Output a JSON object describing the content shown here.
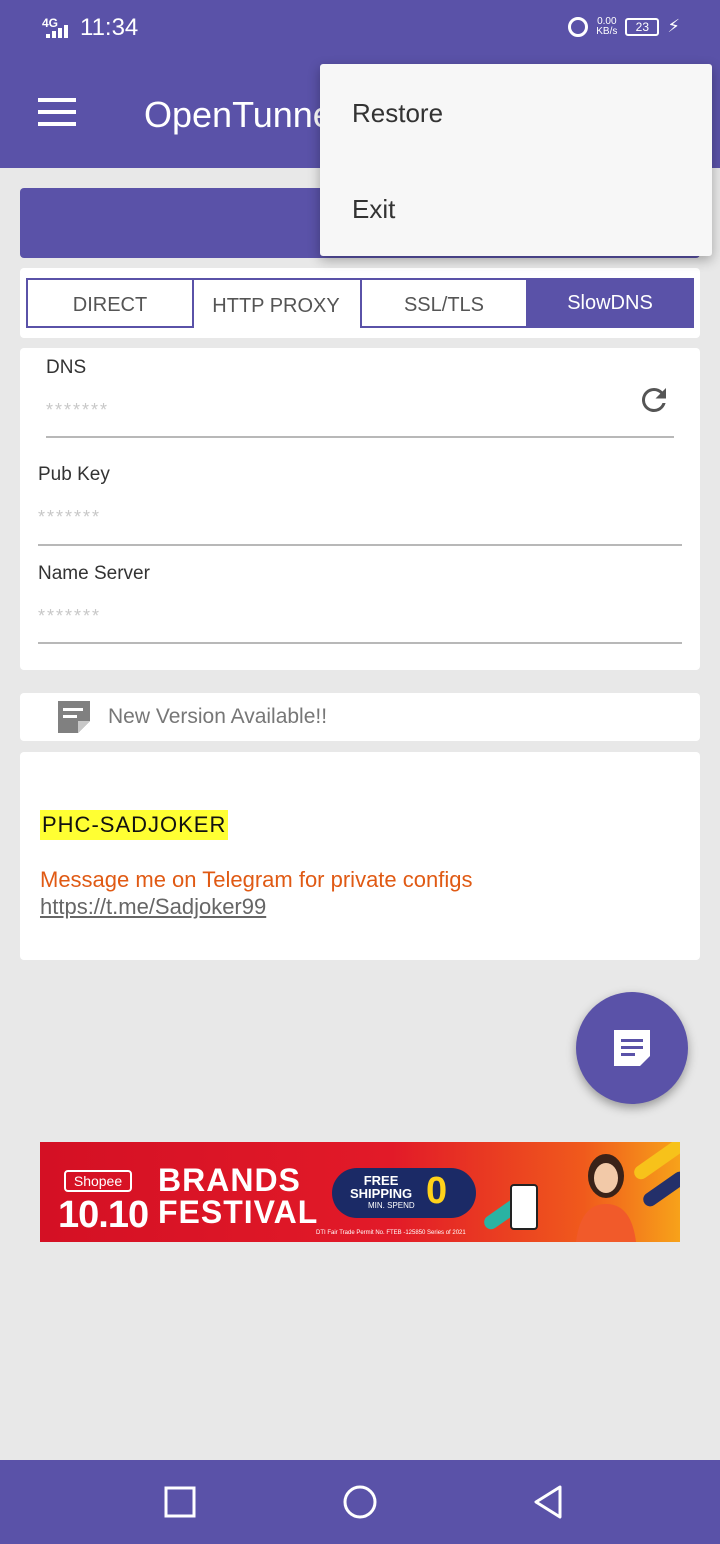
{
  "status_bar": {
    "network": "4G",
    "time": "11:34",
    "speed_value": "0.00",
    "speed_unit": "KB/s",
    "battery": "23",
    "icons": [
      "signal-icon",
      "alarm-icon",
      "battery-icon",
      "charging-icon"
    ]
  },
  "app_bar": {
    "title": "OpenTunnel",
    "menu_icon": "hamburger-menu-icon"
  },
  "tabs": [
    {
      "label": "DIRECT",
      "active": false
    },
    {
      "label": "HTTP PROXY",
      "active": false
    },
    {
      "label": "SSL/TLS",
      "active": false
    },
    {
      "label": "SlowDNS",
      "active": true
    }
  ],
  "form": {
    "dns": {
      "label": "DNS",
      "value": "*******"
    },
    "pub_key": {
      "label": "Pub Key",
      "value": "*******"
    },
    "name_server": {
      "label": "Name Server",
      "value": "*******"
    },
    "refresh_icon": "refresh-icon"
  },
  "notice": {
    "text": "New Version Available!!",
    "icon": "note-icon"
  },
  "message": {
    "tag": "PHC-SADJOKER",
    "text": "Message me on Telegram for private configs",
    "link": "https://t.me/Sadjoker99"
  },
  "fab": {
    "icon": "document-icon"
  },
  "banner": {
    "brand": "Shopee",
    "date": "10.10",
    "headline_1": "BRANDS",
    "headline_2": "FESTIVAL",
    "free": "FREE",
    "shipping": "SHIPPING",
    "zero": "0",
    "min_spend": "MIN. SPEND",
    "permit": "DTI Fair Trade Permit No. FTEB -125850 Series of 2021"
  },
  "overflow_menu": {
    "items": [
      "Restore",
      "Exit"
    ]
  },
  "nav_bar": {
    "icons": [
      "recents-square-icon",
      "home-circle-icon",
      "back-triangle-icon"
    ]
  },
  "colors": {
    "primary": "#5a52a8",
    "background": "#e8e8e8",
    "highlight": "#ffff33",
    "message": "#e05a14"
  }
}
